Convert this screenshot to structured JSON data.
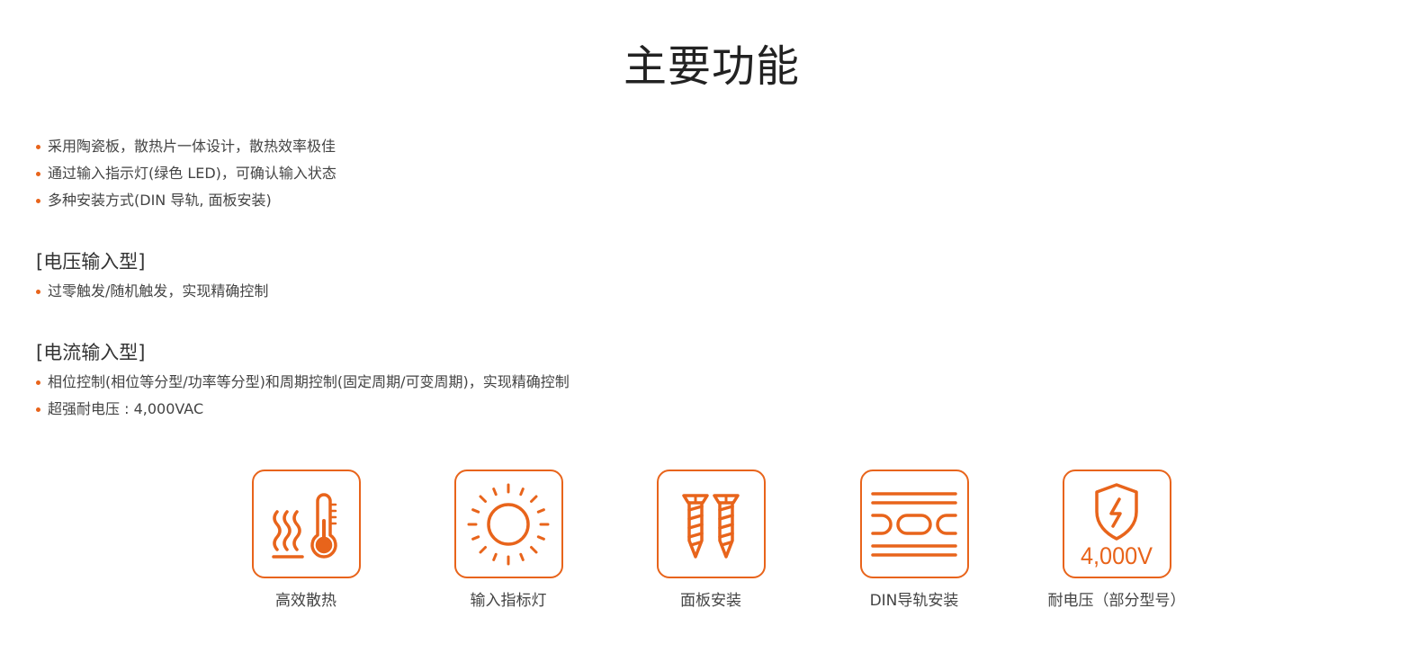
{
  "title": "主要功能",
  "general_features": [
    "采用陶瓷板，散热片一体设计，散热效率极佳",
    "通过输入指示灯(绿色 LED)，可确认输入状态",
    "多种安装方式(DIN 导轨, 面板安装)"
  ],
  "voltage_type": {
    "heading": "[电压输入型]",
    "items": [
      "过零触发/随机触发，实现精确控制"
    ]
  },
  "current_type": {
    "heading": "[电流输入型]",
    "items": [
      "相位控制(相位等分型/功率等分型)和周期控制(固定周期/可变周期)，实现精确控制",
      "超强耐电压 : 4,000VAC"
    ]
  },
  "features": [
    {
      "icon": "heat-dissipation-icon",
      "label": "高效散热"
    },
    {
      "icon": "input-indicator-icon",
      "label": "输入指标灯"
    },
    {
      "icon": "panel-mount-screws-icon",
      "label": "面板安装"
    },
    {
      "icon": "din-rail-icon",
      "label": "DIN导轨安装"
    },
    {
      "icon": "voltage-shield-icon",
      "label": "耐电压（部分型号）",
      "badge_text": "4,000V"
    }
  ],
  "accent_color": "#e8641b"
}
